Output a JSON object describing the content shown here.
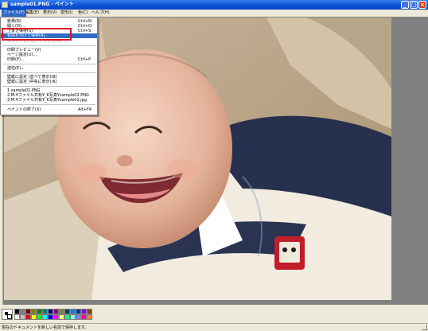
{
  "window": {
    "title": "sample01.PNG - ペイント",
    "minimize_glyph": "_",
    "maximize_glyph": "□",
    "close_glyph": "×"
  },
  "menubar": {
    "items": [
      "ファイル(F)",
      "編集(E)",
      "表示(V)",
      "変形(I)",
      "色(C)",
      "ヘルプ(H)"
    ],
    "active_index": 0
  },
  "file_menu": {
    "items": [
      {
        "label": "新規(N)",
        "shortcut": "Ctrl+N"
      },
      {
        "label": "開く(O)...",
        "shortcut": "Ctrl+O"
      },
      {
        "label": "上書き保存(S)",
        "shortcut": "Ctrl+S"
      },
      {
        "label": "名前を付けて保存(A)...",
        "shortcut": ""
      },
      {
        "label": "スキャナまたはカメラから(M)...",
        "shortcut": ""
      },
      {
        "label": "印刷プレビュー(V)",
        "shortcut": ""
      },
      {
        "label": "ページ設定(U)...",
        "shortcut": ""
      },
      {
        "label": "印刷(P)...",
        "shortcut": "Ctrl+P"
      },
      {
        "label": "送信(E)...",
        "shortcut": ""
      },
      {
        "label": "壁紙に設定 (並べて表示)(B)",
        "shortcut": ""
      },
      {
        "label": "壁紙に設定 (中央に表示)(K)",
        "shortcut": ""
      },
      {
        "label": "1 sample01.PNG",
        "shortcut": ""
      },
      {
        "label": "2 M:¥ファイル共有¥_K写真¥sample02.PNG",
        "shortcut": ""
      },
      {
        "label": "3 M:¥ファイル共有¥_K写真¥sample02.jpg",
        "shortcut": ""
      },
      {
        "label": "ペイントの終了(X)",
        "shortcut": "Alt+F4"
      }
    ],
    "highlighted_index": 3
  },
  "palette": {
    "foreground": "#000000",
    "background": "#ffffff",
    "colors": [
      "#000000",
      "#808080",
      "#800000",
      "#808000",
      "#008000",
      "#008080",
      "#000080",
      "#800080",
      "#808040",
      "#004040",
      "#0080ff",
      "#004080",
      "#8000ff",
      "#804000",
      "#ffffff",
      "#c0c0c0",
      "#ff0000",
      "#ffff00",
      "#00ff00",
      "#00ffff",
      "#0000ff",
      "#ff00ff",
      "#ffff80",
      "#00ff80",
      "#80ffff",
      "#8080ff",
      "#ff0080",
      "#ff8040"
    ]
  },
  "status": {
    "text": "現在のドキュメントを新しい名前で保存します。"
  },
  "icons": {
    "app": "paint-app-icon",
    "size_grip": "resize-grip-icon"
  },
  "colors": {
    "titlebar": "#0a52d4",
    "highlight": "#316ac5",
    "annotation": "#e0102a"
  }
}
